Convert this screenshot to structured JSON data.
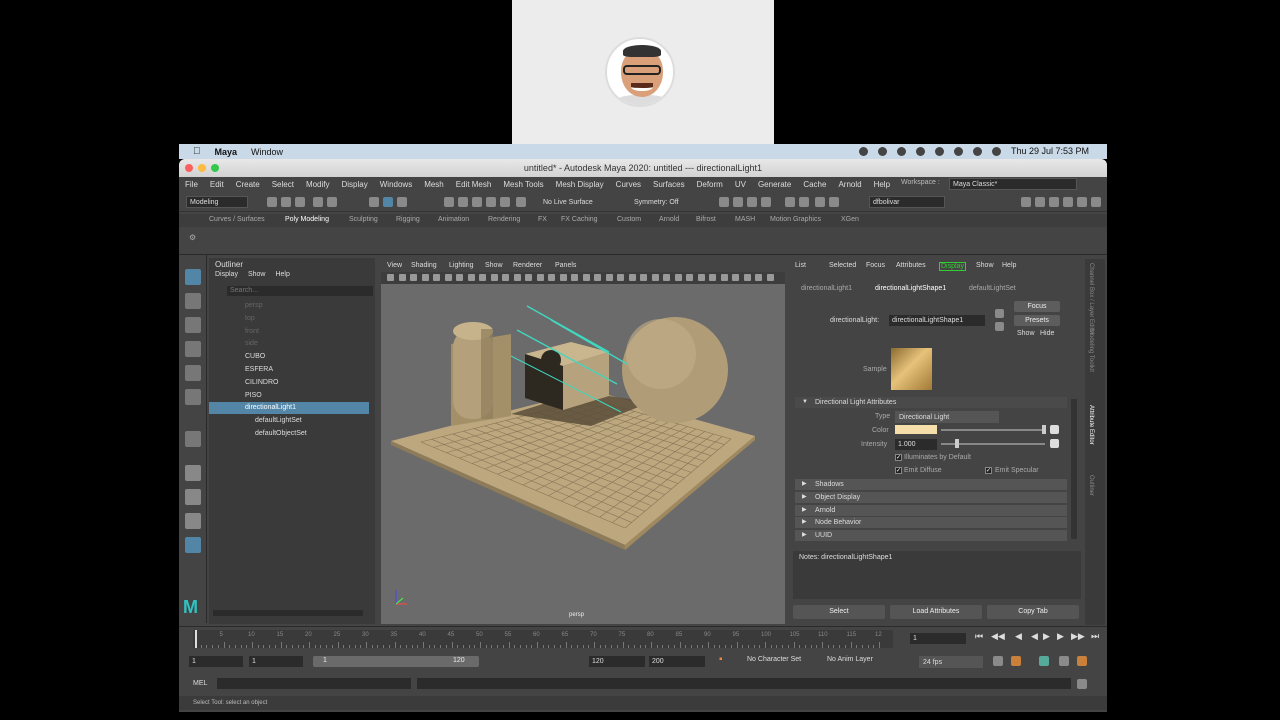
{
  "menubar": {
    "app": "Maya",
    "window": "Window",
    "datetime": "Thu 29 Jul  7:53 PM"
  },
  "window": {
    "title": "untitled* - Autodesk Maya 2020: untitled   ---   directionalLight1"
  },
  "main_menu": [
    "File",
    "Edit",
    "Create",
    "Select",
    "Modify",
    "Display",
    "Windows",
    "Mesh",
    "Edit Mesh",
    "Mesh Tools",
    "Mesh Display",
    "Curves",
    "Surfaces",
    "Deform",
    "UV",
    "Generate",
    "Cache",
    "Arnold",
    "Help"
  ],
  "workspace": {
    "label": "Workspace :",
    "value": "Maya Classic*"
  },
  "status_line": {
    "menu_set": "Modeling",
    "live_surface": "No Live Surface",
    "symmetry": "Symmetry: Off",
    "user": "dfbolivar"
  },
  "shelf_tabs": [
    "Curves / Surfaces",
    "Poly Modeling",
    "Sculpting",
    "Rigging",
    "Animation",
    "Rendering",
    "FX",
    "FX Caching",
    "Custom",
    "Arnold",
    "Bifrost",
    "MASH",
    "Motion Graphics",
    "XGen"
  ],
  "shelf_active_tab": "Poly Modeling",
  "outliner": {
    "title": "Outliner",
    "menu": [
      "Display",
      "Show",
      "Help"
    ],
    "search_placeholder": "Search...",
    "items": [
      {
        "label": "persp",
        "dim": true
      },
      {
        "label": "top",
        "dim": true
      },
      {
        "label": "front",
        "dim": true
      },
      {
        "label": "side",
        "dim": true
      },
      {
        "label": "CUBO",
        "dim": false
      },
      {
        "label": "ESFERA",
        "dim": false
      },
      {
        "label": "CILINDRO",
        "dim": false
      },
      {
        "label": "PISO",
        "dim": false
      },
      {
        "label": "directionalLight1",
        "dim": false,
        "selected": true
      },
      {
        "label": "defaultLightSet",
        "dim": false
      },
      {
        "label": "defaultObjectSet",
        "dim": false
      }
    ]
  },
  "viewport": {
    "menu": [
      "View",
      "Shading",
      "Lighting",
      "Show",
      "Renderer",
      "Panels"
    ],
    "camera_label": "persp"
  },
  "attribute_editor": {
    "menu": [
      "List",
      "Selected",
      "Focus",
      "Attributes",
      "Display",
      "Show",
      "Help"
    ],
    "tabs": [
      "directionalLight1",
      "directionalLightShape1",
      "defaultLightSet"
    ],
    "active_tab": "directionalLightShape1",
    "node_label": "directionalLight:",
    "node_value": "directionalLightShape1",
    "buttons": {
      "focus": "Focus",
      "presets": "Presets",
      "show": "Show",
      "hide": "Hide"
    },
    "sample_label": "Sample",
    "section_title": "Directional Light Attributes",
    "type_label": "Type",
    "type_value": "Directional Light",
    "color_label": "Color",
    "color_hex": "#f5deaa",
    "intensity_label": "Intensity",
    "intensity_value": "1.000",
    "checks": {
      "illuminates": "Illuminates by Default",
      "emit_diffuse": "Emit Diffuse",
      "emit_specular": "Emit Specular"
    },
    "collapsed_sections": [
      "Shadows",
      "Object Display",
      "Arnold",
      "Node Behavior",
      "UUID"
    ],
    "notes_label": "Notes:  directionalLightShape1",
    "bottom_buttons": [
      "Select",
      "Load Attributes",
      "Copy Tab"
    ]
  },
  "side_tabs": [
    "Channel Box / Layer Editor",
    "Modeling Toolkit",
    "Attribute Editor",
    "Outliner"
  ],
  "time_slider": {
    "ticks": [
      "5",
      "10",
      "15",
      "20",
      "25",
      "30",
      "35",
      "40",
      "45",
      "50",
      "55",
      "60",
      "65",
      "70",
      "75",
      "80",
      "85",
      "90",
      "95",
      "100",
      "105",
      "110",
      "115",
      "12"
    ],
    "current_frame": "1"
  },
  "range": {
    "start": "1",
    "start2": "1",
    "range_start": "1",
    "range_end": "120",
    "end": "120",
    "end2": "200",
    "character_set": "No Character Set",
    "anim_layer": "No Anim Layer",
    "fps": "24 fps"
  },
  "command_line": {
    "label": "MEL"
  },
  "help_line": "Select Tool: select an object"
}
